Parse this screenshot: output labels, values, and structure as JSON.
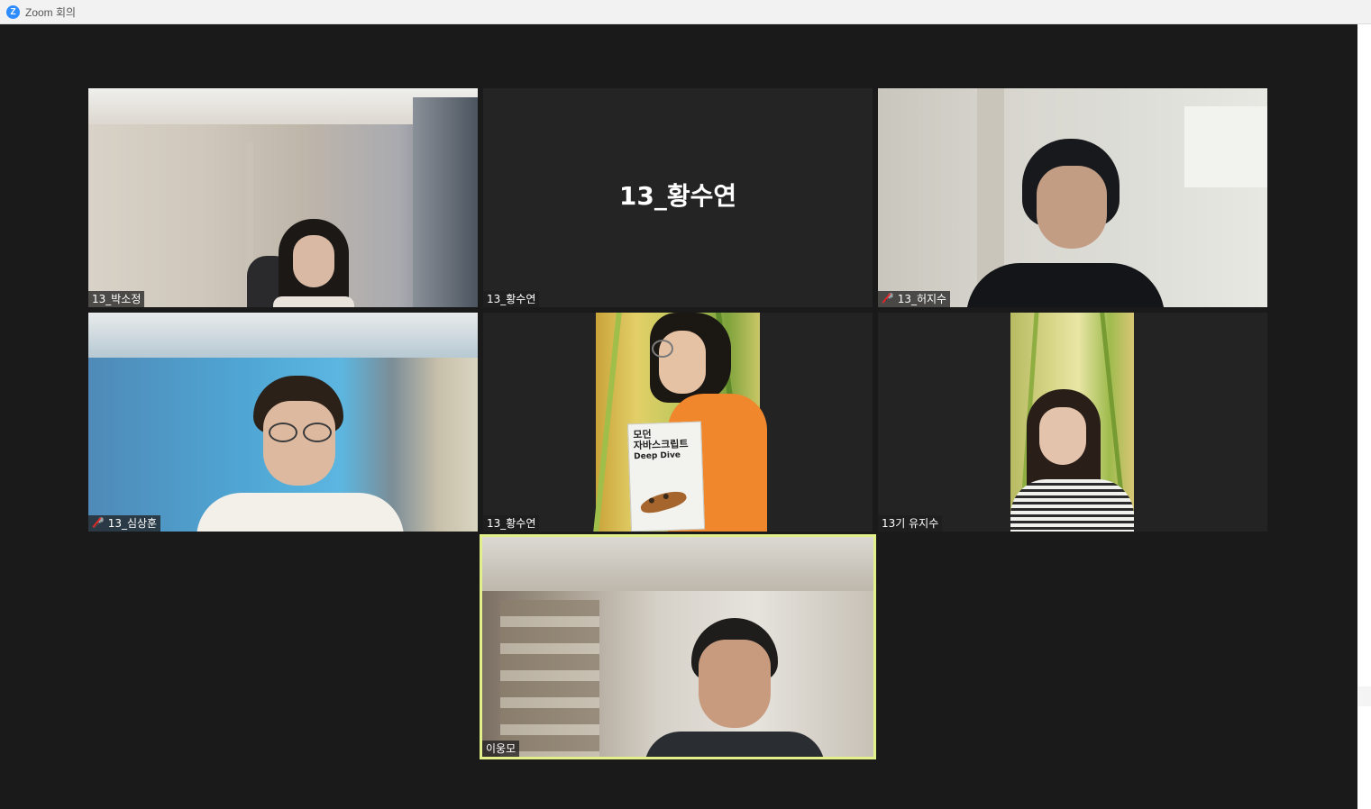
{
  "window": {
    "title": "Zoom 회의",
    "app_icon": "zoom-logo-icon",
    "accent": "#2d8cff"
  },
  "participants": [
    {
      "name": "13_박소정",
      "muted": false,
      "video": true
    },
    {
      "name": "13_황수연",
      "muted": false,
      "video": false,
      "display_name": "13_황수연"
    },
    {
      "name": "13_허지수",
      "muted": true,
      "video": true
    },
    {
      "name": "13_심상훈",
      "muted": true,
      "video": true
    },
    {
      "name": "13_황수연",
      "muted": false,
      "video": true
    },
    {
      "name": "13기 유지수",
      "muted": false,
      "video": true
    },
    {
      "name": "이웅모",
      "muted": false,
      "video": true,
      "active_speaker": true
    }
  ],
  "book": {
    "title_line1": "모던",
    "title_line2": "자바스크립트",
    "title_line3": "Deep Dive"
  },
  "colors": {
    "active_speaker_border": "#e2f08a",
    "muted_icon": "#e02828",
    "background": "#1a1a1a"
  }
}
